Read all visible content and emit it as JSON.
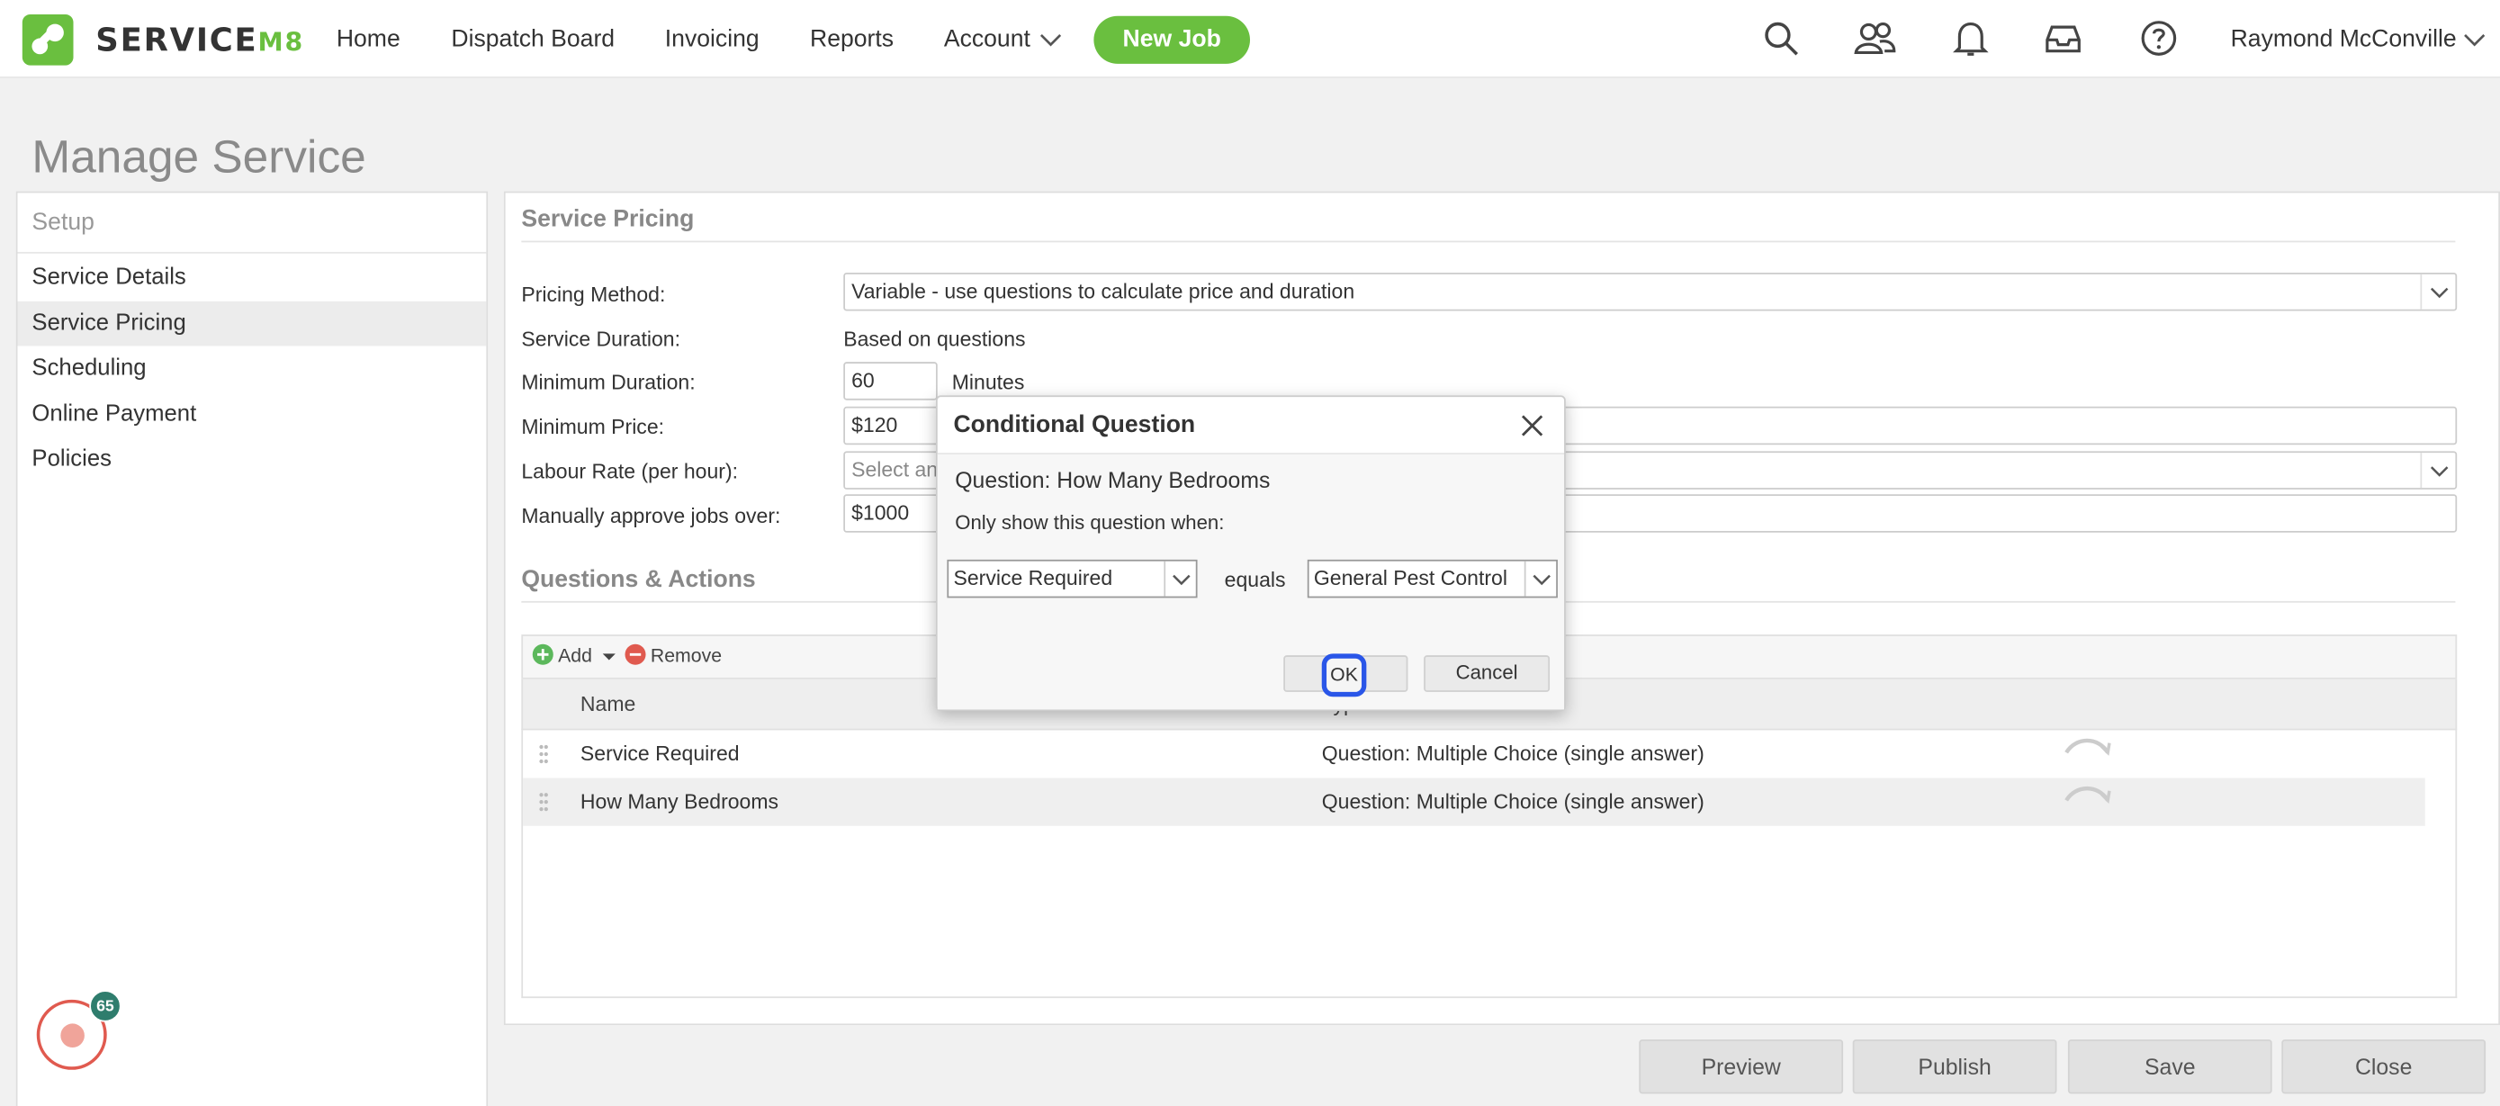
{
  "app": {
    "brand_main": "SERVICE",
    "brand_suffix": "M8",
    "accent": "#6abf3f"
  },
  "nav": {
    "items": [
      "Home",
      "Dispatch Board",
      "Invoicing",
      "Reports",
      "Account"
    ],
    "new_job": "New Job",
    "user": "Raymond McConville",
    "icons": [
      "search-icon",
      "people-icon",
      "bell-icon",
      "inbox-icon",
      "help-icon"
    ]
  },
  "page": {
    "title": "Manage Service"
  },
  "sidebar": {
    "header": "Setup",
    "items": [
      {
        "label": "Service Details",
        "active": false
      },
      {
        "label": "Service Pricing",
        "active": true
      },
      {
        "label": "Scheduling",
        "active": false
      },
      {
        "label": "Online Payment",
        "active": false
      },
      {
        "label": "Policies",
        "active": false
      }
    ]
  },
  "pricing": {
    "section_title": "Service Pricing",
    "method_label": "Pricing Method:",
    "method_value": "Variable - use questions to calculate price and duration",
    "duration_label": "Service Duration:",
    "duration_value": "Based on questions",
    "min_duration_label": "Minimum Duration:",
    "min_duration_value": "60",
    "min_duration_unit": "Minutes",
    "min_price_label": "Minimum Price:",
    "min_price_value": "$120",
    "labour_label": "Labour Rate (per hour):",
    "labour_placeholder": "Select an",
    "approve_label": "Manually approve jobs over:",
    "approve_value": "$1000"
  },
  "questions": {
    "section_title": "Questions & Actions",
    "add_label": "Add",
    "remove_label": "Remove",
    "col_name": "Name",
    "col_type": "Type",
    "rows": [
      {
        "name": "Service Required",
        "type": "Question: Multiple Choice (single answer)"
      },
      {
        "name": "How Many Bedrooms",
        "type": "Question: Multiple Choice (single answer)"
      }
    ]
  },
  "footer": {
    "preview": "Preview",
    "publish": "Publish",
    "save": "Save",
    "close": "Close"
  },
  "badge": {
    "count": "65"
  },
  "dialog": {
    "title": "Conditional Question",
    "question": "Question: How Many Bedrooms",
    "only_show": "Only show this question when:",
    "field_value": "Service Required",
    "operator": "equals",
    "match_value": "General Pest Control",
    "ok": "OK",
    "cancel": "Cancel"
  }
}
